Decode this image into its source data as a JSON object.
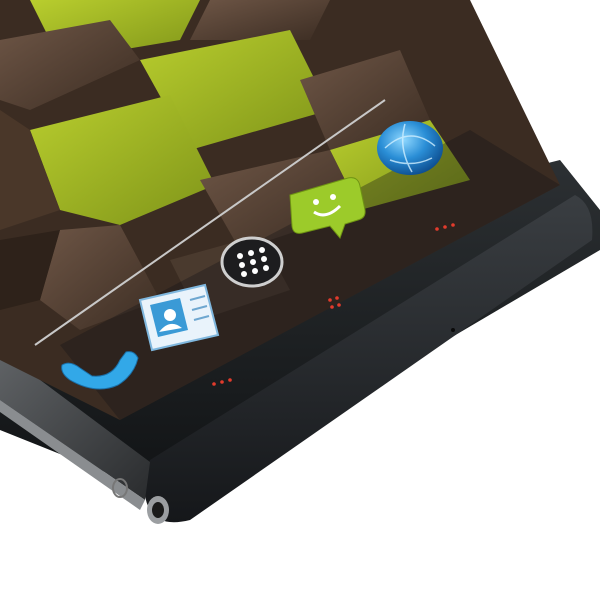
{
  "photo": {
    "subject": "smartphone-bottom-edge",
    "colors": {
      "background": "#ffffff",
      "bezel": "#1f2224",
      "frame": "#2b2e31",
      "tile_green": "#a3b825",
      "tile_brown": "#5a4537",
      "key_dots": "#e0392b"
    }
  },
  "screen": {
    "wallpaper": "3d-cubes-green-brown",
    "dock": {
      "items": [
        {
          "id": "phone",
          "icon": "phone-handset-icon"
        },
        {
          "id": "contacts",
          "icon": "contacts-card-icon"
        },
        {
          "id": "apps",
          "icon": "app-drawer-icon"
        },
        {
          "id": "messaging",
          "icon": "messaging-bubble-icon"
        },
        {
          "id": "browser",
          "icon": "globe-icon"
        }
      ]
    }
  },
  "hardware": {
    "keys": [
      "back-key",
      "home-key",
      "menu-key"
    ],
    "ports": [
      "headphone-jack",
      "usb-port"
    ]
  }
}
